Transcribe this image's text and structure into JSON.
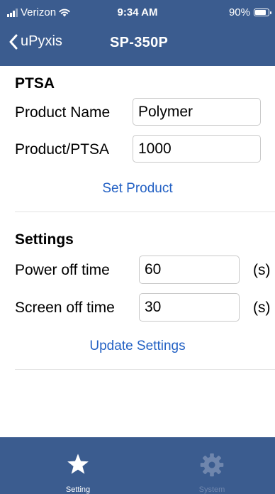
{
  "status_bar": {
    "carrier": "Verizon",
    "time": "9:34 AM",
    "battery": "90%",
    "battery_level": 0.9
  },
  "nav": {
    "back_label": "uPyxis",
    "title": "SP-350P"
  },
  "ptsa": {
    "heading": "PTSA",
    "product_name_label": "Product Name",
    "product_name_value": "Polymer",
    "product_ptsa_label": "Product/PTSA",
    "product_ptsa_value": "1000",
    "set_button": "Set Product"
  },
  "settings": {
    "heading": "Settings",
    "power_off_label": "Power off time",
    "power_off_value": "60",
    "power_off_unit": "(s)",
    "screen_off_label": "Screen off time",
    "screen_off_value": "30",
    "screen_off_unit": "(s)",
    "update_button": "Update Settings"
  },
  "tabs": [
    {
      "label": "Setting",
      "icon": "star-icon",
      "active": true
    },
    {
      "label": "System",
      "icon": "gear-icon",
      "active": false
    }
  ],
  "colors": {
    "bar": "#3b5c8f",
    "accent": "#2361c4",
    "inactive_tab": "#6f86ad"
  }
}
